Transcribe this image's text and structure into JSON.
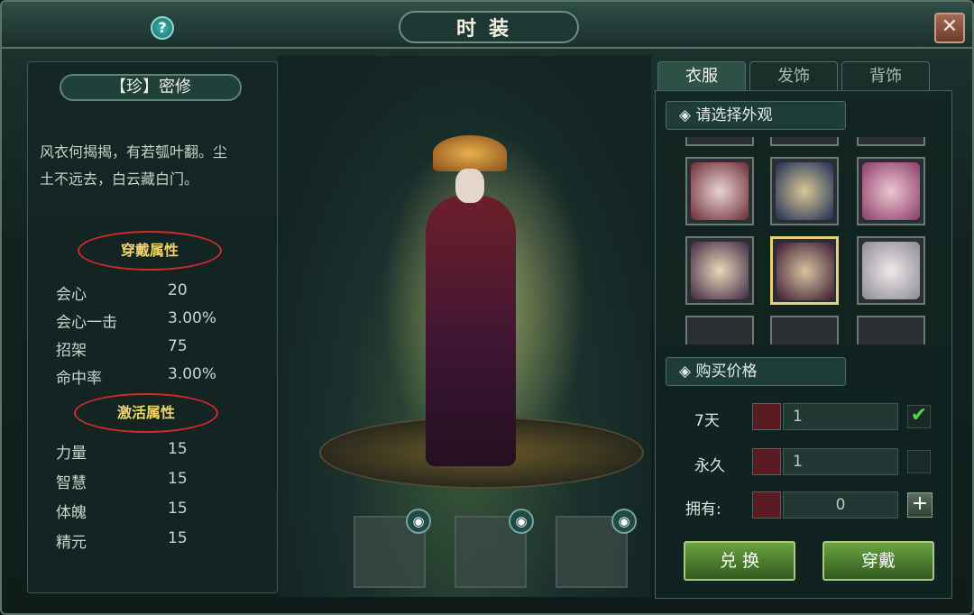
{
  "window": {
    "title": "时装",
    "help_label": "?",
    "close_label": "✕"
  },
  "item": {
    "name": "【珍】密修",
    "description_lines": [
      "风衣何揭揭，有若瓠叶翻。尘",
      "土不远去，白云藏白门。"
    ]
  },
  "wear_attributes": {
    "header": "穿戴属性",
    "rows": [
      {
        "label": "会心",
        "value": "20"
      },
      {
        "label": "会心一击",
        "value": "3.00%"
      },
      {
        "label": "招架",
        "value": "75"
      },
      {
        "label": "命中率",
        "value": "3.00%"
      }
    ]
  },
  "activate_attributes": {
    "header": "激活属性",
    "rows": [
      {
        "label": "力量",
        "value": "15"
      },
      {
        "label": "智慧",
        "value": "15"
      },
      {
        "label": "体魄",
        "value": "15"
      },
      {
        "label": "精元",
        "value": "15"
      }
    ]
  },
  "tabs": [
    {
      "label": "衣服",
      "active": true
    },
    {
      "label": "发饰",
      "active": false
    },
    {
      "label": "背饰",
      "active": false
    }
  ],
  "select_header": "◈ 请选择外观",
  "purchase_header": "◈ 购买价格",
  "purchase": {
    "rows": [
      {
        "label": "7天",
        "value": "1",
        "checked": true
      },
      {
        "label": "永久",
        "value": "1",
        "checked": false
      }
    ],
    "owned_label": "拥有:",
    "owned_value": "0",
    "plus_label": "+"
  },
  "buttons": {
    "exchange": "兑 换",
    "wear": "穿戴"
  },
  "colors": {
    "accent_gold": "#e4d37a",
    "button_green": "#6aa33f",
    "check_green": "#4fd54a"
  },
  "icons": {
    "eye": "eye-icon",
    "diamond": "diamond-icon"
  }
}
